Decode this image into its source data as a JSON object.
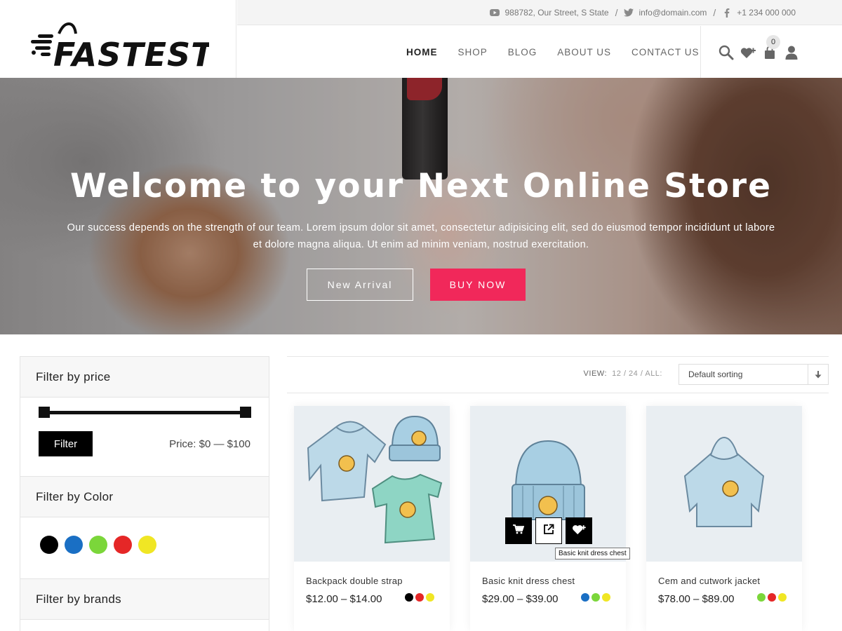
{
  "logo": {
    "text": "FASTEST"
  },
  "topbar": {
    "address": "988782, Our Street, S State",
    "email": "info@domain.com",
    "phone": "+1 234 000 000",
    "separator": "/"
  },
  "nav": {
    "items": [
      "Home",
      "Shop",
      "Blog",
      "About Us",
      "Contact Us"
    ],
    "active": "Home"
  },
  "header_icons": {
    "search": "search-icon",
    "wishlist": "heart-plus-icon",
    "cart": "bag-icon",
    "cart_count": "0",
    "account": "user-icon"
  },
  "hero": {
    "title": "Welcome to your Next Online Store",
    "text_line1": "Our success depends on the strength of our team. Lorem ipsum dolor sit amet, consectetur adipisicing elit, sed do eiusmod tempor incididunt ut labore",
    "text_line2": "et dolore magna aliqua. Ut enim ad minim veniam, nostrud exercitation.",
    "btn_secondary": "New Arrival",
    "btn_primary": "BUY NOW",
    "accent": "#f1285a"
  },
  "sidebar": {
    "price": {
      "title": "Filter by price",
      "filter_button": "Filter",
      "price_label": "Price: $0 — $100",
      "range_min": 0,
      "range_max": 100
    },
    "color": {
      "title": "Filter by Color",
      "swatches": [
        "#000000",
        "#1a6fc4",
        "#7bd63a",
        "#e52727",
        "#f0e624"
      ]
    },
    "brands": {
      "title": "Filter by brands"
    }
  },
  "toolbar": {
    "view_label": "VIEW:",
    "view_options": "12 / 24 / ALL:",
    "sort_value": "Default sorting"
  },
  "products": [
    {
      "title": "Backpack double strap",
      "price": "$12.00 – $14.00",
      "colors": [
        "#000000",
        "#e52727",
        "#f0e624"
      ]
    },
    {
      "title": "Basic knit dress chest",
      "price": "$29.00 – $39.00",
      "colors": [
        "#1a6fc4",
        "#7bd63a",
        "#f0e624"
      ]
    },
    {
      "title": "Cem and cutwork jacket",
      "price": "$78.00 – $89.00",
      "colors": [
        "#7bd63a",
        "#e52727",
        "#f0e624"
      ]
    }
  ],
  "quick_actions": {
    "cart": "cart-icon",
    "view": "external-link-icon",
    "wishlist": "heart-plus-icon",
    "tooltip": "Basic knit dress chest"
  }
}
